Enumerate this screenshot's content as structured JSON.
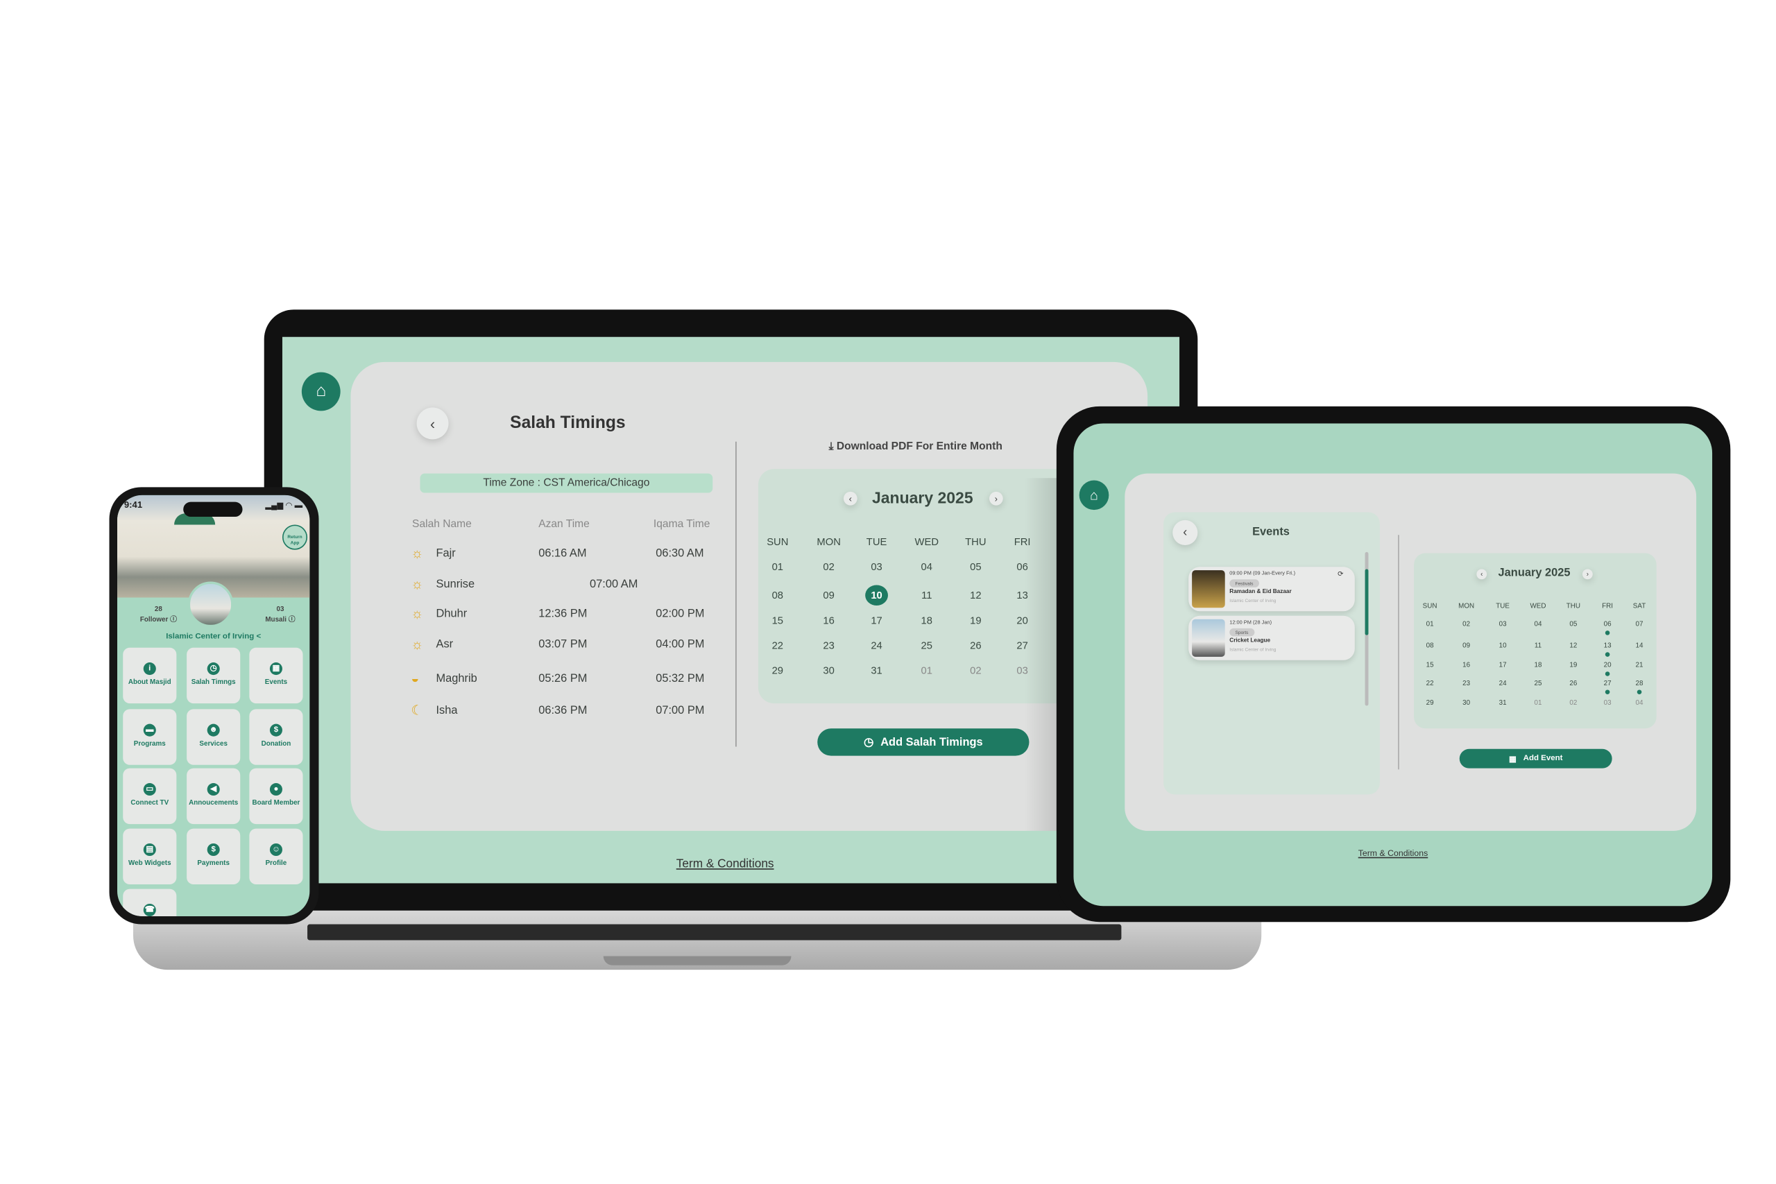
{
  "colors": {
    "accent": "#1e7a62",
    "mint": "#b5dcc9",
    "card": "#dfe0df",
    "calendar_bg": "#cfe0d6",
    "event_dot": "#1e7a62",
    "prayer_icon": "#e0a820"
  },
  "laptop": {
    "title": "Salah Timings",
    "timezone": "Time Zone : CST America/Chicago",
    "columns": [
      "Salah Name",
      "Azan Time",
      "Iqama Time"
    ],
    "prayers": [
      {
        "name": "Fajr",
        "azan": "06:16 AM",
        "iqama": "06:30 AM",
        "icon": "sunrise-icon"
      },
      {
        "name": "Sunrise",
        "azan": "07:00 AM",
        "iqama": "",
        "icon": "sun-up-icon"
      },
      {
        "name": "Dhuhr",
        "azan": "12:36 PM",
        "iqama": "02:00 PM",
        "icon": "sun-icon"
      },
      {
        "name": "Asr",
        "azan": "03:07 PM",
        "iqama": "04:00 PM",
        "icon": "sun-icon"
      },
      {
        "name": "Maghrib",
        "azan": "05:26 PM",
        "iqama": "05:32 PM",
        "icon": "sunset-icon"
      },
      {
        "name": "Isha",
        "azan": "06:36 PM",
        "iqama": "07:00 PM",
        "icon": "moon-icon"
      }
    ],
    "download": "Download PDF For Entire Month",
    "month": "January 2025",
    "weekdays": [
      "SUN",
      "MON",
      "TUE",
      "WED",
      "THU",
      "FRI"
    ],
    "days": [
      [
        "01",
        "02",
        "03",
        "04",
        "05",
        "06"
      ],
      [
        "08",
        "09",
        "10",
        "11",
        "12",
        "13"
      ],
      [
        "15",
        "16",
        "17",
        "18",
        "19",
        "20"
      ],
      [
        "22",
        "23",
        "24",
        "25",
        "26",
        "27"
      ],
      [
        "29",
        "30",
        "31",
        "01",
        "02",
        "03"
      ]
    ],
    "selected_day": "10",
    "add_button": "Add Salah Timings",
    "terms": "Term & Conditions"
  },
  "tablet": {
    "title": "Events",
    "events": [
      {
        "time": "09:00 PM (09 Jan-Every Fri.)",
        "tag": "Festivals",
        "name": "Ramadan & Eid Bazaar",
        "org": "Islamic Center of Irving",
        "recurring": true
      },
      {
        "time": "12:00 PM (28 Jan)",
        "tag": "Sports",
        "name": "Cricket League",
        "org": "Islamic Center of Irving",
        "recurring": false
      }
    ],
    "month": "January 2025",
    "weekdays": [
      "SUN",
      "MON",
      "TUE",
      "WED",
      "THU",
      "FRI",
      "SAT"
    ],
    "days": [
      [
        "01",
        "02",
        "03",
        "04",
        "05",
        "06",
        "07"
      ],
      [
        "08",
        "09",
        "10",
        "11",
        "12",
        "13",
        "14"
      ],
      [
        "15",
        "16",
        "17",
        "18",
        "19",
        "20",
        "21"
      ],
      [
        "22",
        "23",
        "24",
        "25",
        "26",
        "27",
        "28"
      ],
      [
        "29",
        "30",
        "31",
        "01",
        "02",
        "03",
        "04"
      ]
    ],
    "event_days": [
      "06",
      "13",
      "20",
      "27",
      "28"
    ],
    "add_button": "Add Event",
    "terms": "Term & Conditions"
  },
  "phone": {
    "time": "9:41",
    "return_badge": "Return App",
    "followers": {
      "count": "28",
      "label": "Follower"
    },
    "musali": {
      "count": "03",
      "label": "Musali"
    },
    "name": "Islamic Center of Irving",
    "tiles": [
      {
        "label": "About Masjid",
        "icon": "info-icon",
        "glyph": "i"
      },
      {
        "label": "Salah Timngs",
        "icon": "clock-icon",
        "glyph": "◷"
      },
      {
        "label": "Events",
        "icon": "calendar-icon",
        "glyph": "▦"
      },
      {
        "label": "Programs",
        "icon": "presentation-icon",
        "glyph": "▬"
      },
      {
        "label": "Services",
        "icon": "service-icon",
        "glyph": "☻"
      },
      {
        "label": "Donation",
        "icon": "donation-hand-icon",
        "glyph": "$"
      },
      {
        "label": "Connect TV",
        "icon": "tv-cast-icon",
        "glyph": "▭"
      },
      {
        "label": "Annoucements",
        "icon": "megaphone-icon",
        "glyph": "◀"
      },
      {
        "label": "Board Member",
        "icon": "group-icon",
        "glyph": "●"
      },
      {
        "label": "Web Widgets",
        "icon": "widget-icon",
        "glyph": "▤"
      },
      {
        "label": "Payments",
        "icon": "payment-icon",
        "glyph": "$"
      },
      {
        "label": "Profile",
        "icon": "profile-icon",
        "glyph": "☺"
      },
      {
        "label": "",
        "icon": "support-icon",
        "glyph": "☎"
      }
    ]
  }
}
